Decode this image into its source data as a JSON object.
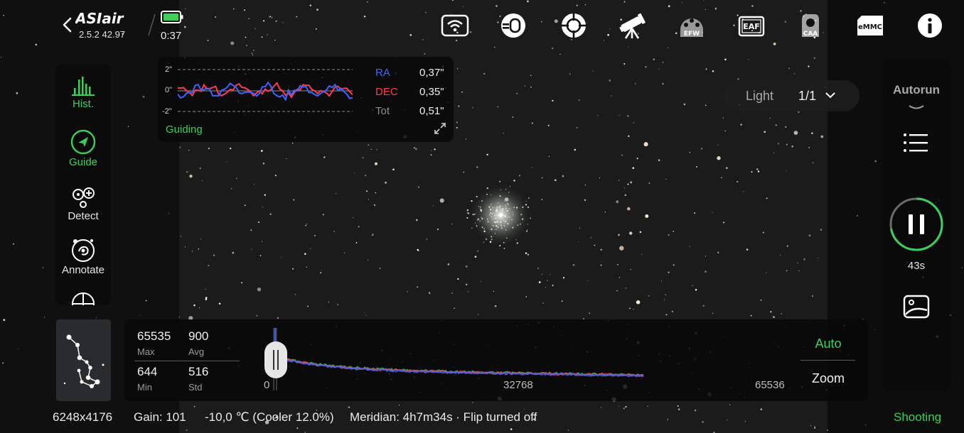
{
  "header": {
    "logo_text": "ASIair",
    "version": "2.5.2 42.97",
    "battery_time": "0:37",
    "icons": [
      "wifi-icon",
      "camera-icon",
      "guide-scope-icon",
      "telescope-icon",
      "efw-icon",
      "eaf-icon",
      "caa-icon",
      "emmc-icon",
      "info-icon"
    ],
    "efw_label": "EFW",
    "eaf_label": "EAF",
    "caa_label": "CAA",
    "emmc_label": "eMMC"
  },
  "left_panel": {
    "items": [
      {
        "label": "Hist.",
        "icon": "histogram-icon",
        "active": true
      },
      {
        "label": "Guide",
        "icon": "guide-icon",
        "active": true
      },
      {
        "label": "Detect",
        "icon": "detect-icon",
        "active": false
      },
      {
        "label": "Annotate",
        "icon": "annotate-icon",
        "active": false
      }
    ]
  },
  "guiding": {
    "label": "Guiding",
    "axis_top": "2\"",
    "axis_mid": "0\"",
    "axis_bottom": "-2\"",
    "ra_label": "RA",
    "ra_value": "0,37\"",
    "dec_label": "DEC",
    "dec_value": "0,35\"",
    "tot_label": "Tot",
    "tot_value": "0,51\"",
    "ra_color": "#3f63ff",
    "dec_color": "#ff3b52"
  },
  "light_selector": {
    "type": "Light",
    "count": "1/1"
  },
  "right_panel": {
    "autorun_label": "Autorun",
    "countdown": "43s"
  },
  "histogram": {
    "max_value": "65535",
    "max_label": "Max",
    "avg_value": "900",
    "avg_label": "Avg",
    "min_value": "644",
    "min_label": "Min",
    "std_value": "516",
    "std_label": "Std",
    "tick_0": "0",
    "tick_mid": "32768",
    "tick_max": "65536",
    "auto_label": "Auto",
    "zoom_label": "Zoom"
  },
  "status_bar": {
    "resolution": "6248x4176",
    "gain": "Gain: 101",
    "temperature": "-10,0 ℃ (Cooler 12.0%)",
    "meridian": "Meridian: 4h7m34s · Flip turned off",
    "state": "Shooting"
  },
  "colors": {
    "accent_green": "#3ccf5a",
    "panel_bg": "#0a0a0a"
  }
}
